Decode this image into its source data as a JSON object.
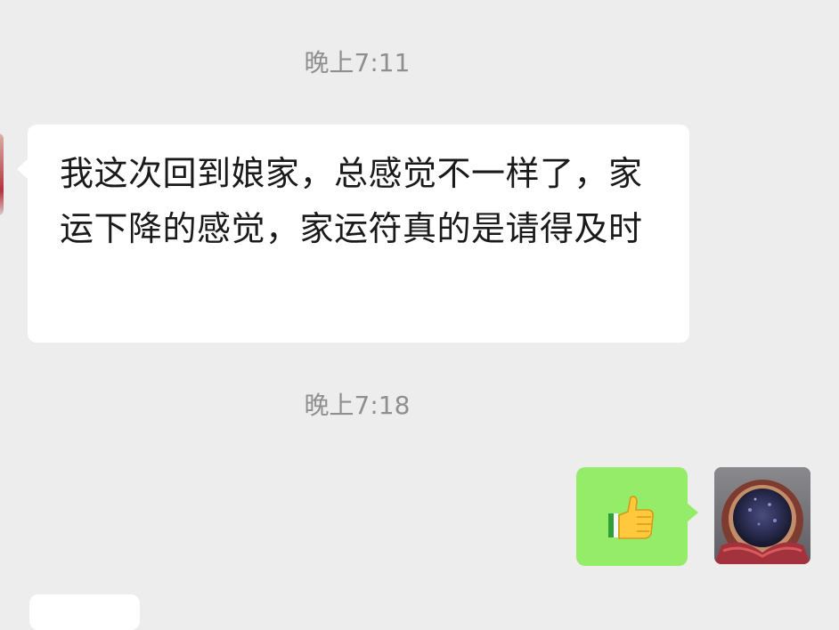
{
  "chat": {
    "timestamp_1": "晚上7:11",
    "incoming_message": "我这次回到娘家，总感觉不一样了，家运下降的感觉，家运符真的是请得及时",
    "timestamp_2": "晚上7:18",
    "outgoing_message": {
      "icon": "thumbs-up-icon"
    }
  },
  "colors": {
    "background": "#ededed",
    "incoming_bubble": "#ffffff",
    "outgoing_bubble": "#95ec69",
    "timestamp_text": "#8f8f8f",
    "message_text": "#1a1a1a"
  }
}
